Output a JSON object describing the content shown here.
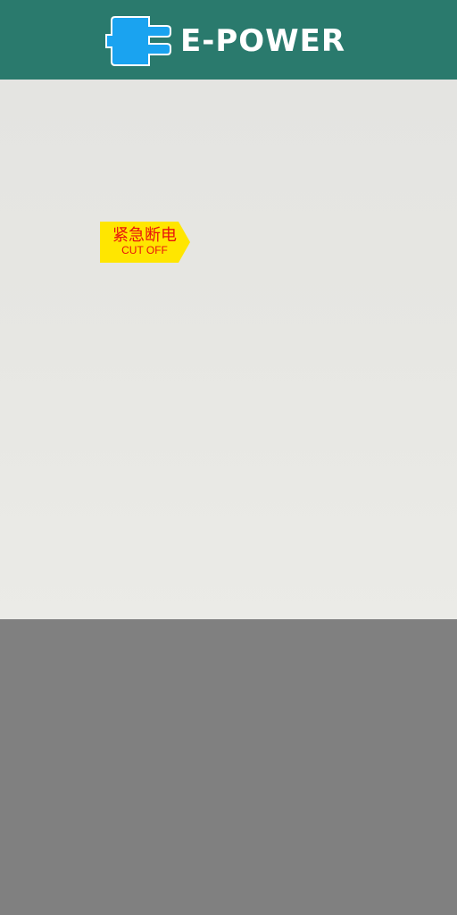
{
  "header": {
    "brand": "E-POWER",
    "logo_icon": "plug-icon",
    "background_color": "#2a7a6d",
    "logo_color": "#1aa3f0"
  },
  "emergency": {
    "label_cn": "紧急断电",
    "label_en": "CUT OFF",
    "background_color": "#ffe600",
    "text_color": "#e8140c"
  }
}
